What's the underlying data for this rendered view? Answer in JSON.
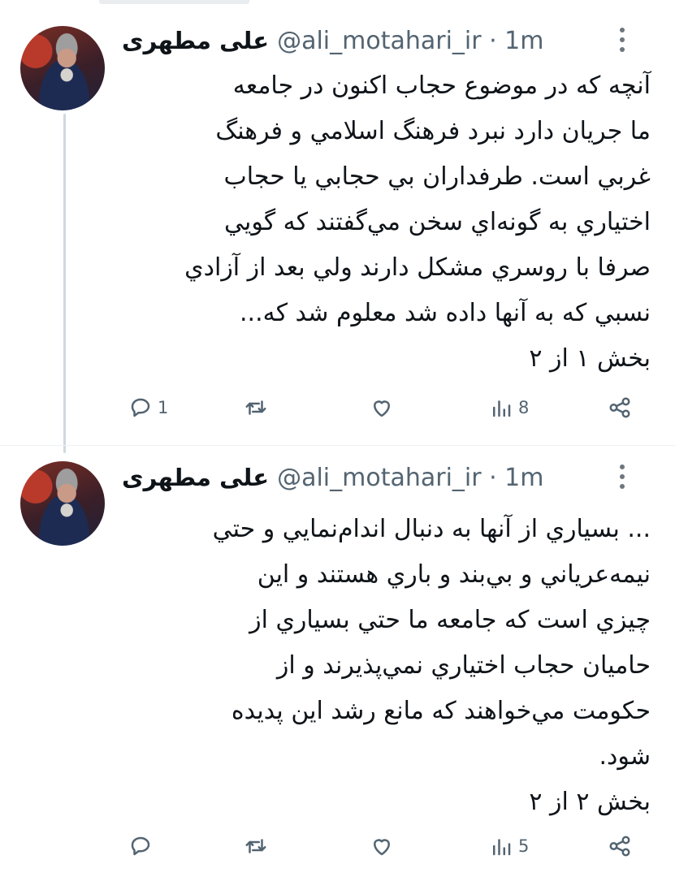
{
  "tweets": [
    {
      "author": {
        "name": "علی مطهری",
        "handle_time": "@ali_motahari_ir · 1m"
      },
      "text": "آنچه که در موضوع حجاب اکنون در جامعه\nما جريان دارد نبرد فرهنگ اسلامي و فرهنگ\nغربي است. طرفداران بي حجابي يا حجاب\nاختياري به گونه‌اي سخن مي‌گفتند كه گويي\nصرفا با روسري مشكل دارند ولي بعد از آزادي\nنسبي كه به آنها داده شد معلوم شد كه...\nبخش ١ از ٢",
      "actions": {
        "reply_count": "1",
        "retweet_count": "",
        "like_count": "",
        "view_count": "8"
      },
      "icons": {
        "more": "more-icon",
        "reply": "reply-icon",
        "retweet": "retweet-icon",
        "like": "heart-icon",
        "views": "views-icon",
        "share": "share-icon"
      }
    },
    {
      "author": {
        "name": "علی مطهری",
        "handle_time": "@ali_motahari_ir · 1m"
      },
      "text": "... بسياري از آنها به دنبال اندام‌نمايي و حتي\nنيمه‌عرياني و بي‌بند و باري هستند و اين\nچيزي است كه جامعه ما حتي بسياري از\nحاميان حجاب اختياري نمي‌پذيرند و از\nحكومت مي‌خواهند كه مانع رشد اين پديده\nشود.\nبخش ٢ از ٢",
      "actions": {
        "reply_count": "",
        "retweet_count": "",
        "like_count": "",
        "view_count": "5"
      },
      "icons": {
        "more": "more-icon",
        "reply": "reply-icon",
        "retweet": "retweet-icon",
        "like": "heart-icon",
        "views": "views-icon",
        "share": "share-icon"
      }
    }
  ],
  "colors": {
    "text": "#0f1419",
    "secondary": "#536471",
    "thread_line": "#cfd9de",
    "background": "#ffffff"
  }
}
